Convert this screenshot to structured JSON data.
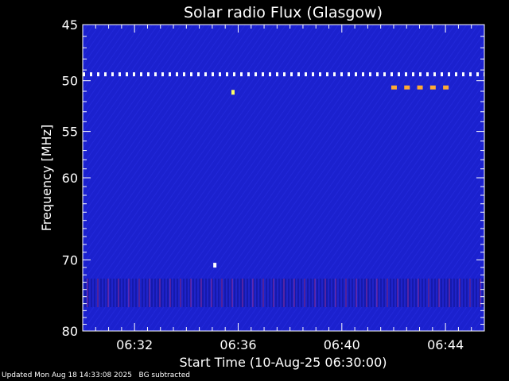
{
  "chart_data": {
    "type": "heatmap",
    "title": "Solar radio Flux (Glasgow)",
    "xlabel": "Start Time (10-Aug-25 06:30:00)",
    "ylabel": "Frequency [MHz]",
    "x_range_minutes": [
      0,
      15.5
    ],
    "xticks": [
      {
        "value": 2,
        "label": "06:32"
      },
      {
        "value": 6,
        "label": "06:36"
      },
      {
        "value": 10,
        "label": "06:40"
      },
      {
        "value": 14,
        "label": "06:44"
      }
    ],
    "y_scale": "log",
    "y_range_mhz": [
      45,
      80
    ],
    "yticks_major": [
      45,
      50,
      55,
      60,
      70,
      80
    ],
    "yticks_minor": [
      46,
      47,
      48,
      49,
      51,
      52,
      53,
      54,
      56,
      57,
      58,
      59,
      61,
      62,
      63,
      64,
      65,
      66,
      67,
      68,
      69,
      71,
      72,
      73,
      74,
      75,
      76,
      77,
      78,
      79
    ],
    "background_color": "#1a1fd0",
    "features": [
      {
        "name": "interference line",
        "frequency_mhz": 49.4,
        "time_min": [
          0,
          15.5
        ],
        "color": "#ffffff",
        "style": "dashed"
      },
      {
        "name": "bursts",
        "frequency_mhz": 50.6,
        "times_min": [
          12.0,
          12.5,
          13.0,
          13.5,
          14.0
        ],
        "color": "#ffaa33"
      },
      {
        "name": "spot",
        "frequency_mhz": 51.1,
        "time_min": 5.8,
        "color": "#ffff66"
      },
      {
        "name": "spot",
        "frequency_mhz": 70.7,
        "time_min": 5.1,
        "color": "#ffffff"
      },
      {
        "name": "striped band",
        "frequency_range_mhz": [
          72.5,
          76.5
        ],
        "color": "#c03080"
      }
    ]
  },
  "footer": {
    "updated": "Updated Mon Aug 18 14:33:08 2025",
    "note": "BG subtracted"
  }
}
